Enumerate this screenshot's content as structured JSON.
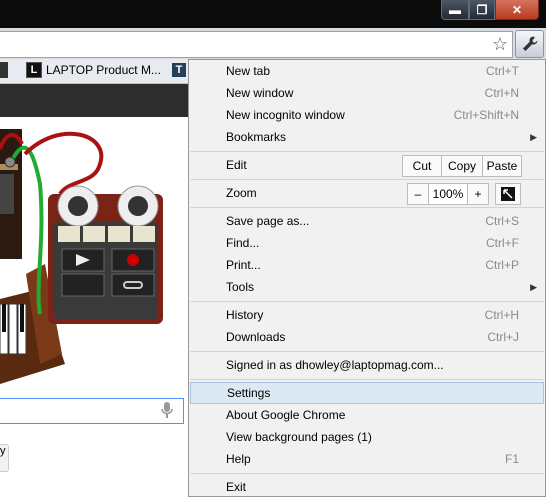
{
  "window": {
    "minimize_glyph": "▬",
    "maximize_glyph": "❐",
    "close_glyph": "✕"
  },
  "toolbar": {
    "star_glyph": "☆"
  },
  "bookmarks": {
    "items": [
      {
        "label": "LAPTOP Product M...",
        "favicon": "L"
      }
    ],
    "next_favicon": "T"
  },
  "page": {
    "button_fragment": "y"
  },
  "menu": {
    "new_tab": {
      "label": "New tab",
      "shortcut": "Ctrl+T"
    },
    "new_window": {
      "label": "New window",
      "shortcut": "Ctrl+N"
    },
    "new_incognito": {
      "label": "New incognito window",
      "shortcut": "Ctrl+Shift+N"
    },
    "bookmarks": {
      "label": "Bookmarks"
    },
    "edit": {
      "label": "Edit",
      "cut": "Cut",
      "copy": "Copy",
      "paste": "Paste"
    },
    "zoom": {
      "label": "Zoom",
      "minus": "–",
      "level": "100%",
      "plus": "+"
    },
    "save_page": {
      "label": "Save page as...",
      "shortcut": "Ctrl+S"
    },
    "find": {
      "label": "Find...",
      "shortcut": "Ctrl+F"
    },
    "print": {
      "label": "Print...",
      "shortcut": "Ctrl+P"
    },
    "tools": {
      "label": "Tools"
    },
    "history": {
      "label": "History",
      "shortcut": "Ctrl+H"
    },
    "downloads": {
      "label": "Downloads",
      "shortcut": "Ctrl+J"
    },
    "signed_in": {
      "label": "Signed in as dhowley@laptopmag.com..."
    },
    "settings": {
      "label": "Settings"
    },
    "about": {
      "label": "About Google Chrome"
    },
    "background_pages": {
      "label": "View background pages (1)"
    },
    "help": {
      "label": "Help",
      "shortcut": "F1"
    },
    "exit": {
      "label": "Exit"
    },
    "submenu_arrow": "▶"
  },
  "colors": {
    "highlight": "#dde8f5",
    "shortcut": "#8a8a8a",
    "menu_bg": "#f1f1f1"
  }
}
